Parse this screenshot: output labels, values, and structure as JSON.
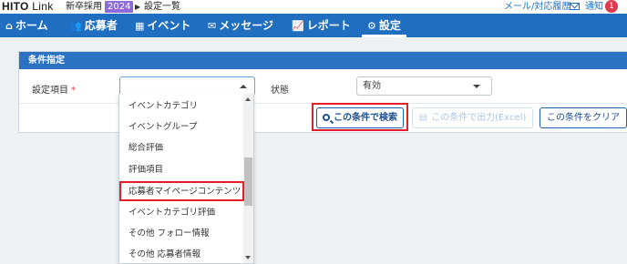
{
  "header": {
    "logo_main": "HITO",
    "logo_link": "Link",
    "brand_sub": "新卒採用",
    "year": "2024",
    "breadcrumb": "設定一覧",
    "mail_link": "メール/対応履歴",
    "notice_label": "通知",
    "notice_count": "1"
  },
  "nav": {
    "home": "ホーム",
    "applicants": "応募者",
    "events": "イベント",
    "messages": "メッセージ",
    "reports": "レポート",
    "settings": "設定"
  },
  "panel": {
    "title": "条件指定",
    "setting_label": "設定項目",
    "required_mark": "*",
    "setting_value": "",
    "status_label": "状態",
    "status_value": "有効"
  },
  "buttons": {
    "search": "この条件で検索",
    "export": "この条件で出力(Excel)",
    "clear": "この条件をクリア"
  },
  "dropdown": {
    "items": [
      "イベントカテゴリ",
      "イベントグループ",
      "総合評価",
      "評価項目",
      "応募者マイページコンテンツ",
      "イベントカテゴリ評価",
      "その他 フォロー情報",
      "その他 応募者情報"
    ]
  },
  "colors": {
    "nav_bg": "#1f6ebf",
    "panel_head": "#2b72c2",
    "highlight": "#e2202c",
    "year_badge": "#8e6bd8",
    "notice_badge": "#e0394d"
  }
}
